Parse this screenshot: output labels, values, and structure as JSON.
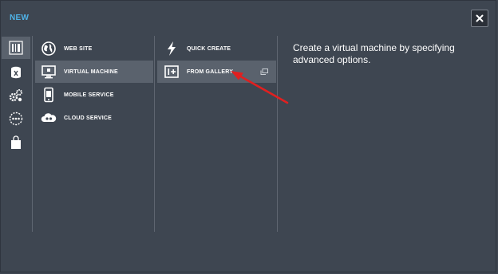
{
  "header": {
    "new_label": "NEW",
    "close_icon": "close-icon"
  },
  "categories": [
    {
      "name": "compute",
      "icon": "compute-icon",
      "active": true
    },
    {
      "name": "data-services",
      "icon": "data-services-icon",
      "active": false
    },
    {
      "name": "app-services",
      "icon": "app-services-icon",
      "active": false
    },
    {
      "name": "network-services",
      "icon": "network-services-icon",
      "active": false
    },
    {
      "name": "store",
      "icon": "store-icon",
      "active": false
    }
  ],
  "compute_items": [
    {
      "label": "WEB SITE",
      "icon": "web-site-icon"
    },
    {
      "label": "VIRTUAL MACHINE",
      "icon": "virtual-machine-icon",
      "active": true
    },
    {
      "label": "MOBILE SERVICE",
      "icon": "mobile-service-icon"
    },
    {
      "label": "CLOUD SERVICE",
      "icon": "cloud-service-icon"
    }
  ],
  "vm_options": [
    {
      "label": "QUICK CREATE",
      "icon": "lightning-icon"
    },
    {
      "label": "FROM GALLERY",
      "icon": "gallery-add-icon",
      "active": true,
      "trailing_icon": "open-dialog-icon"
    }
  ],
  "description": "Create a virtual machine by specifying advanced options.",
  "colors": {
    "background": "#3e4651",
    "selected": "#5a626d",
    "accent": "#4fb3e8",
    "annotation_arrow": "#e02020"
  }
}
